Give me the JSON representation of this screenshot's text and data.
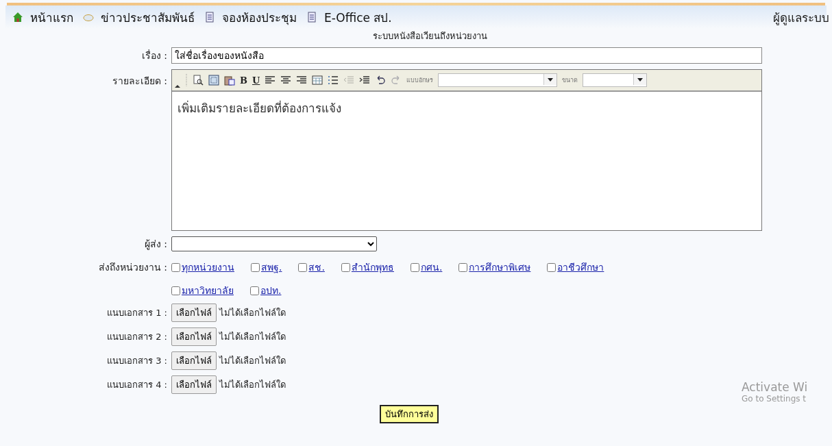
{
  "nav": {
    "items": [
      {
        "label": "หน้าแรก",
        "kind": "home"
      },
      {
        "label": "ข่าวประชาสัมพันธ์",
        "kind": "cloud"
      },
      {
        "label": "จองห้องประชุม",
        "kind": "document"
      },
      {
        "label": "E-Office สป.",
        "kind": "document"
      }
    ],
    "user": "ผู้ดูแลระบบ"
  },
  "title": "ระบบหนังสือเวียนถึงหน่วยงาน",
  "subject": {
    "label": "เรื่อง :",
    "value": "ใส่ชื่อเรื่องของหนังสือ"
  },
  "detail": {
    "label": "รายละเอียด :",
    "toolbar": [
      {
        "kind": "preview",
        "disabled": false
      },
      {
        "kind": "select-all",
        "disabled": false
      },
      {
        "kind": "paste-word",
        "disabled": false
      },
      {
        "kind": "text",
        "label": "B",
        "disabled": false
      },
      {
        "kind": "text",
        "label": "U",
        "disabled": false
      },
      {
        "kind": "align-left",
        "disabled": false
      },
      {
        "kind": "align-center",
        "disabled": false
      },
      {
        "kind": "align-right",
        "disabled": false
      },
      {
        "kind": "table",
        "disabled": false
      },
      {
        "kind": "list",
        "disabled": false
      },
      {
        "kind": "outdent",
        "disabled": true
      },
      {
        "kind": "indent",
        "disabled": false
      },
      {
        "kind": "undo",
        "disabled": false
      },
      {
        "kind": "redo",
        "disabled": true
      }
    ],
    "font_label": "แบบอักษร",
    "size_label": "ขนาด",
    "value": "เพิ่มเติมรายละเอียดที่ต้องการแจ้ง"
  },
  "sender": {
    "label": "ผู้ส่ง :"
  },
  "recipients": {
    "label": "ส่งถึงหน่วยงาน :",
    "options": [
      {
        "label": "ทุกหน่วยงาน",
        "checked": false
      },
      {
        "label": "สพฐ.",
        "checked": false
      },
      {
        "label": "สช.",
        "checked": false
      },
      {
        "label": "สำนักพุทธ",
        "checked": false
      },
      {
        "label": "กศน.",
        "checked": false
      },
      {
        "label": "การศึกษาพิเศษ",
        "checked": false
      },
      {
        "label": "อาชีวศึกษา",
        "checked": false
      },
      {
        "label": "มหาวิทยาลัย",
        "checked": false
      },
      {
        "label": "อปท.",
        "checked": false
      }
    ]
  },
  "attachments": [
    {
      "label": "แนบเอกสาร 1 :",
      "button": "เลือกไฟล์",
      "status": "ไม่ได้เลือกไฟล์ใด"
    },
    {
      "label": "แนบเอกสาร 2 :",
      "button": "เลือกไฟล์",
      "status": "ไม่ได้เลือกไฟล์ใด"
    },
    {
      "label": "แนบเอกสาร 3 :",
      "button": "เลือกไฟล์",
      "status": "ไม่ได้เลือกไฟล์ใด"
    },
    {
      "label": "แนบเอกสาร 4 :",
      "button": "เลือกไฟล์",
      "status": "ไม่ได้เลือกไฟล์ใด"
    }
  ],
  "submit": "บันทึกการส่ง",
  "activation": {
    "title": "Activate Wi",
    "hint": "Go to Settings t"
  }
}
